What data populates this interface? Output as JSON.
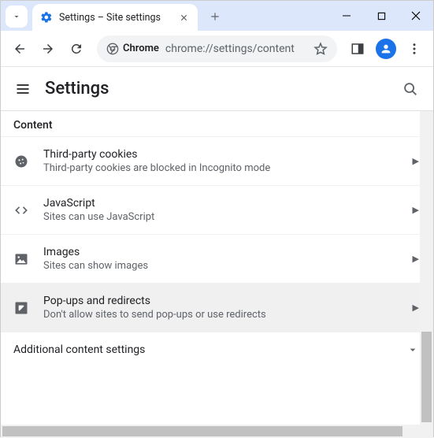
{
  "window": {
    "tab_title": "Settings – Site settings"
  },
  "toolbar": {
    "chrome_chip": "Chrome",
    "url": "chrome://settings/content"
  },
  "header": {
    "title": "Settings"
  },
  "content": {
    "section_label": "Content",
    "rows": [
      {
        "title": "Third-party cookies",
        "sub": "Third-party cookies are blocked in Incognito mode"
      },
      {
        "title": "JavaScript",
        "sub": "Sites can use JavaScript"
      },
      {
        "title": "Images",
        "sub": "Sites can show images"
      },
      {
        "title": "Pop-ups and redirects",
        "sub": "Don't allow sites to send pop-ups or use redirects"
      }
    ],
    "additional_label": "Additional content settings"
  }
}
